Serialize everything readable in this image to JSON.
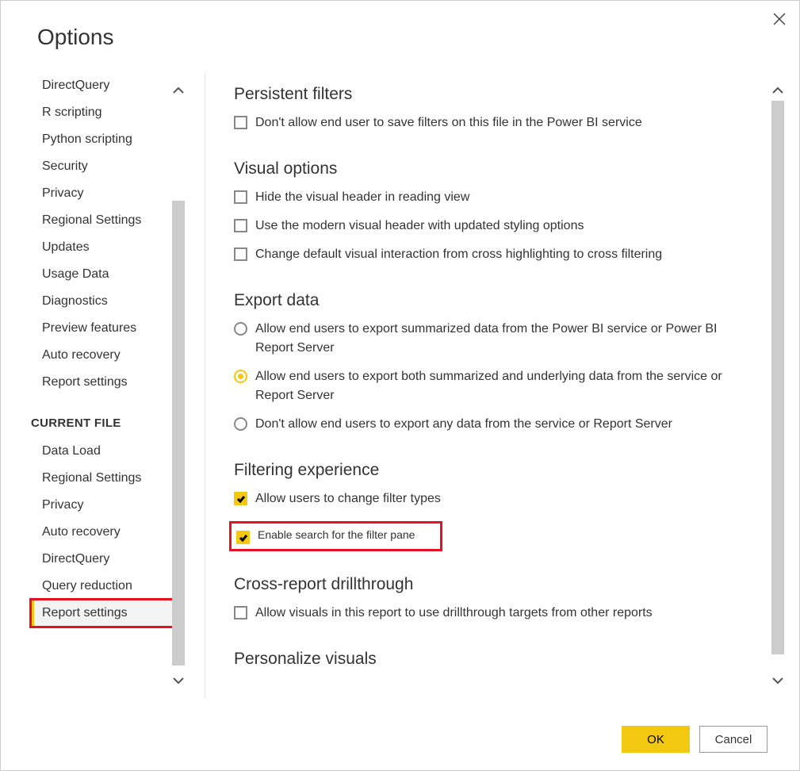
{
  "dialog": {
    "title": "Options"
  },
  "sidebar": {
    "global_items": [
      "DirectQuery",
      "R scripting",
      "Python scripting",
      "Security",
      "Privacy",
      "Regional Settings",
      "Updates",
      "Usage Data",
      "Diagnostics",
      "Preview features",
      "Auto recovery",
      "Report settings"
    ],
    "current_heading": "CURRENT FILE",
    "current_items": [
      "Data Load",
      "Regional Settings",
      "Privacy",
      "Auto recovery",
      "DirectQuery",
      "Query reduction",
      "Report settings"
    ],
    "selected_index_current": 6
  },
  "sections": {
    "persistent_filters": {
      "heading": "Persistent filters",
      "opt1": "Don't allow end user to save filters on this file in the Power BI service"
    },
    "visual_options": {
      "heading": "Visual options",
      "opt1": "Hide the visual header in reading view",
      "opt2": "Use the modern visual header with updated styling options",
      "opt3": "Change default visual interaction from cross highlighting to cross filtering"
    },
    "export_data": {
      "heading": "Export data",
      "opt1": "Allow end users to export summarized data from the Power BI service or Power BI Report Server",
      "opt2": "Allow end users to export both summarized and underlying data from the service or Report Server",
      "opt3": "Don't allow end users to export any data from the service or Report Server",
      "selected": 1
    },
    "filtering_experience": {
      "heading": "Filtering experience",
      "opt1": "Allow users to change filter types",
      "opt2": "Enable search for the filter pane"
    },
    "cross_report": {
      "heading": "Cross-report drillthrough",
      "opt1": "Allow visuals in this report to use drillthrough targets from other reports"
    },
    "personalize": {
      "heading": "Personalize visuals"
    }
  },
  "buttons": {
    "ok": "OK",
    "cancel": "Cancel"
  }
}
